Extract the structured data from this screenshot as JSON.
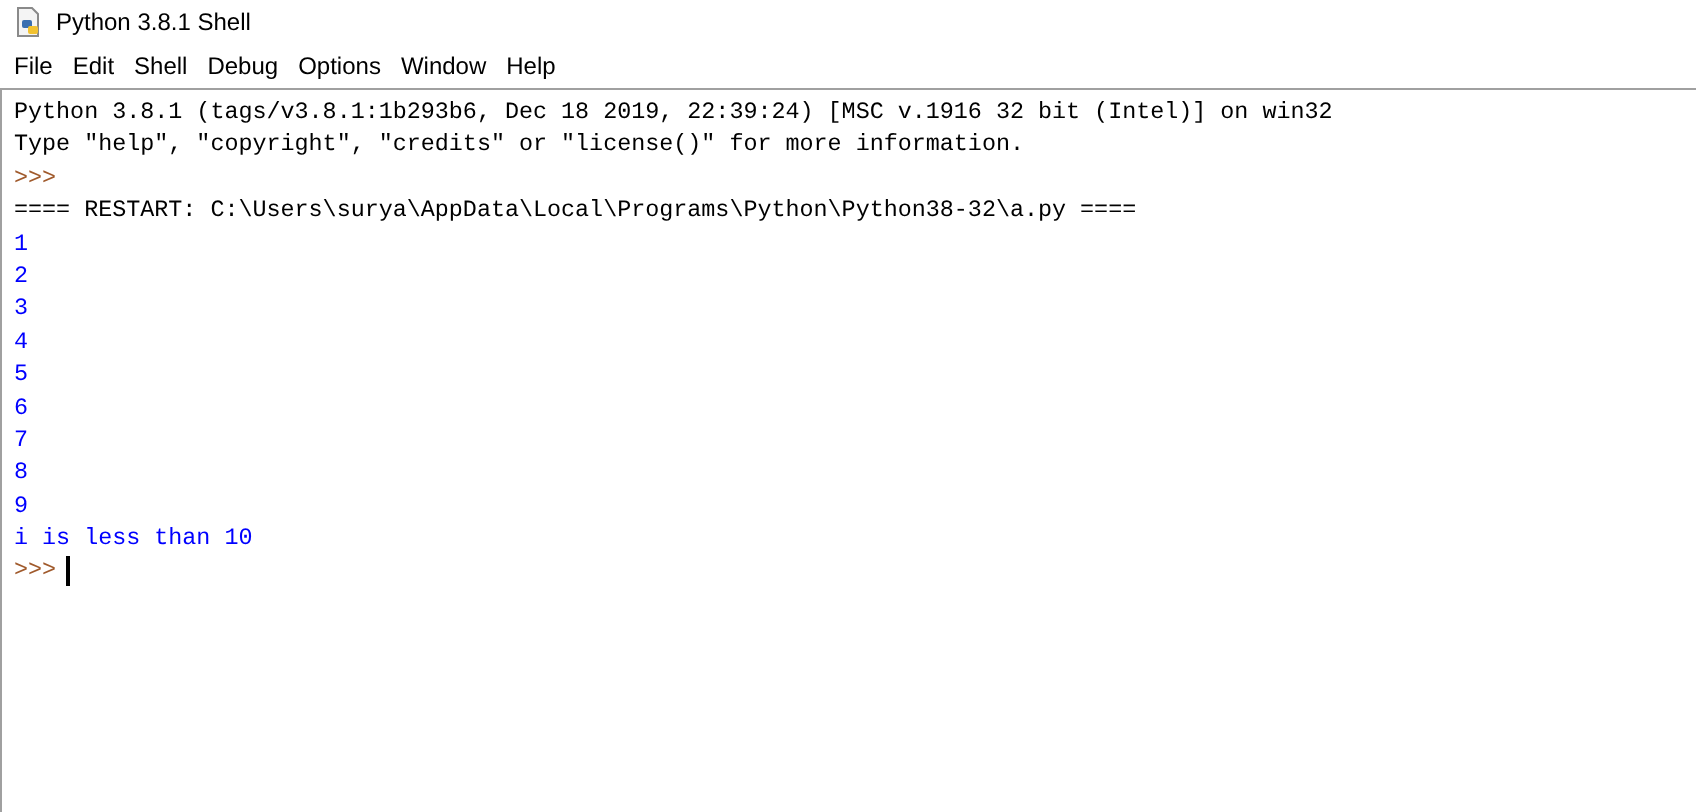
{
  "window": {
    "title": "Python 3.8.1 Shell"
  },
  "menu": [
    "File",
    "Edit",
    "Shell",
    "Debug",
    "Options",
    "Window",
    "Help"
  ],
  "lines": [
    {
      "kind": "banner",
      "text": "Python 3.8.1 (tags/v3.8.1:1b293b6, Dec 18 2019, 22:39:24) [MSC v.1916 32 bit (Intel)] on win32"
    },
    {
      "kind": "banner",
      "text": "Type \"help\", \"copyright\", \"credits\" or \"license()\" for more information."
    },
    {
      "kind": "prompt",
      "text": ">>>"
    },
    {
      "kind": "banner",
      "text": "==== RESTART: C:\\Users\\surya\\AppData\\Local\\Programs\\Python\\Python38-32\\a.py ===="
    },
    {
      "kind": "output",
      "text": "1"
    },
    {
      "kind": "output",
      "text": "2"
    },
    {
      "kind": "output",
      "text": "3"
    },
    {
      "kind": "output",
      "text": "4"
    },
    {
      "kind": "output",
      "text": "5"
    },
    {
      "kind": "output",
      "text": "6"
    },
    {
      "kind": "output",
      "text": "7"
    },
    {
      "kind": "output",
      "text": "8"
    },
    {
      "kind": "output",
      "text": "9"
    },
    {
      "kind": "output",
      "text": "i is less than 10"
    },
    {
      "kind": "prompt",
      "text": ">>>",
      "cursor": true
    }
  ]
}
